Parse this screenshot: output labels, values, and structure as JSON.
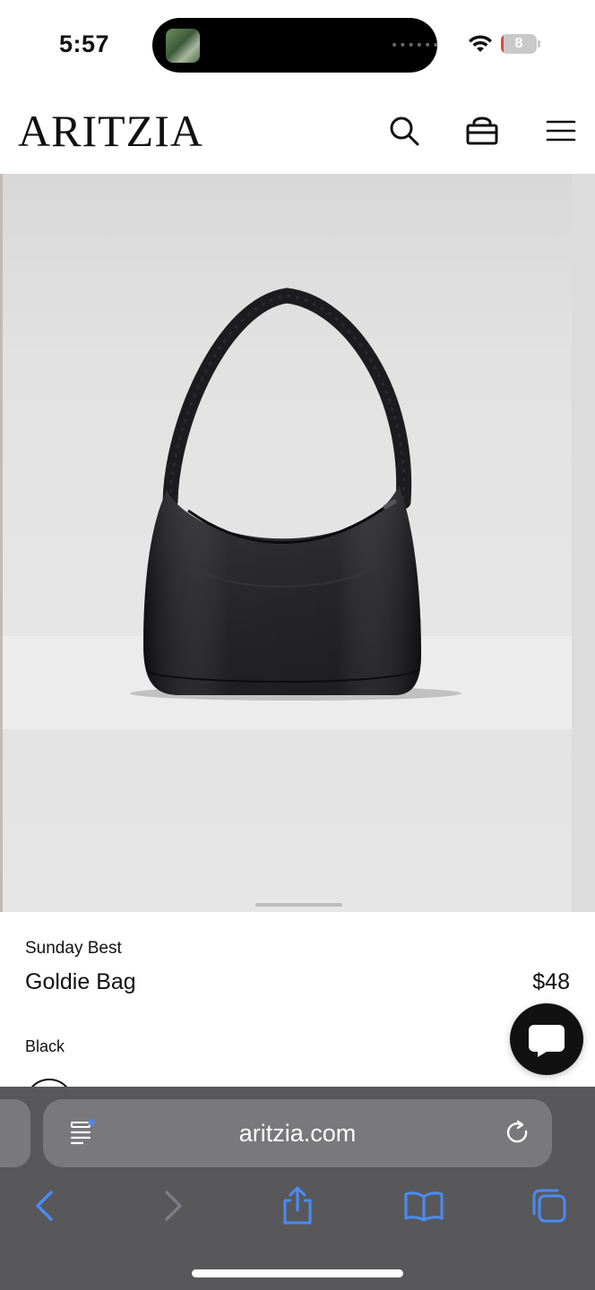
{
  "status_bar": {
    "time": "5:57",
    "battery_level": "8",
    "battery_fraction": 0.08,
    "island_indicator": "••••••"
  },
  "header": {
    "logo": "ARITZIA",
    "icons": [
      "search-icon",
      "bag-icon",
      "menu-icon"
    ]
  },
  "product": {
    "brand": "Sunday Best",
    "name": "Goldie Bag",
    "price": "$48",
    "color_label": "Black",
    "image_alt": "Goldie Bag product photo"
  },
  "chat": {
    "icon": "chat-bubble-icon"
  },
  "browser": {
    "url": "aritzia.com",
    "icons": [
      "reader-icon",
      "reload-icon",
      "back-icon",
      "forward-icon",
      "share-icon",
      "bookmarks-icon",
      "tabs-icon"
    ],
    "accent_color": "#4a8bf5"
  }
}
